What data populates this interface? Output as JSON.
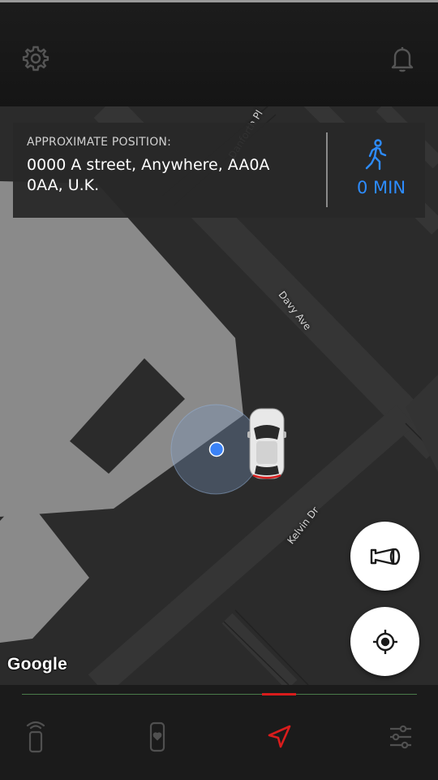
{
  "map": {
    "streets": [
      "Danforth Pl",
      "Davy Ave",
      "Kelvin Dr"
    ],
    "attribution": "Google"
  },
  "info_card": {
    "label": "APPROXIMATE POSITION:",
    "address": "0000 A street, Anywhere, AA0A 0AA, U.K.",
    "eta": "0 MIN"
  },
  "colors": {
    "accent_blue": "#2d8cff",
    "accent_red": "#d91c1c",
    "location_dot": "#3b82f6"
  },
  "icons": {
    "settings": "gear-icon",
    "notifications": "bell-icon",
    "walk": "walking-person-icon",
    "horn": "horn-icon",
    "locate": "crosshair-icon",
    "nav_remote": "key-fob-icon",
    "nav_phone": "phone-heart-icon",
    "nav_navigate": "navigation-arrow-icon",
    "nav_settings": "sliders-icon"
  },
  "bottom_nav": {
    "active_index": 2
  }
}
